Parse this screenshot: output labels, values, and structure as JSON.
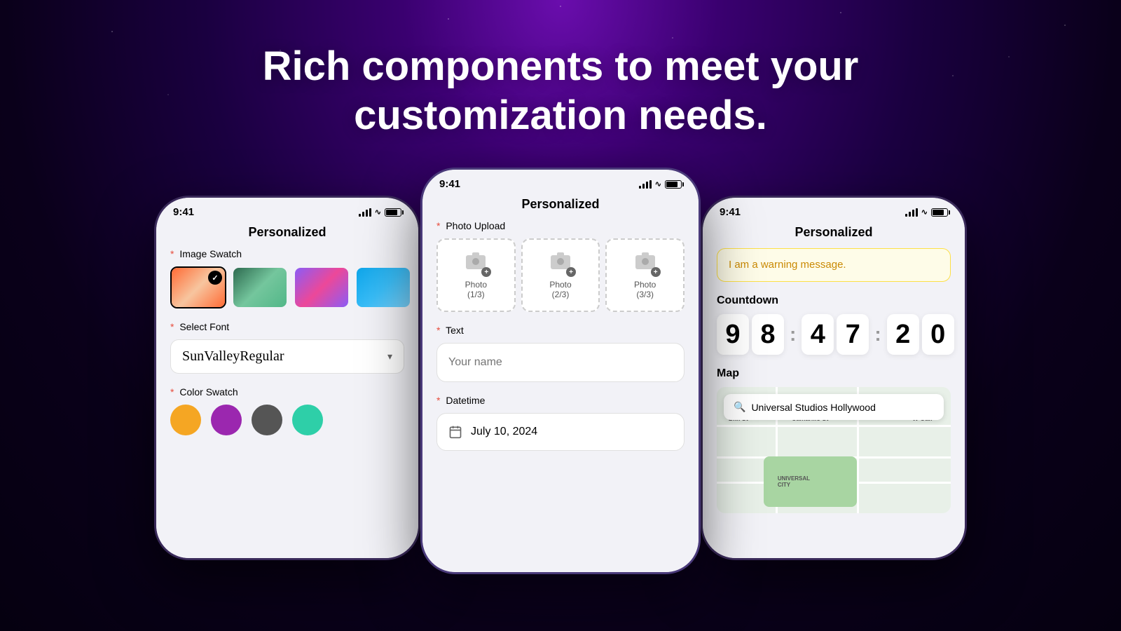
{
  "page": {
    "title_line1": "Rich components to meet  your",
    "title_line2": "customization needs."
  },
  "phone_left": {
    "status_time": "9:41",
    "screen_title": "Personalized",
    "image_swatch": {
      "label": "Image Swatch",
      "required": "*",
      "swatches": [
        {
          "id": "swatch-1",
          "selected": true
        },
        {
          "id": "swatch-2",
          "selected": false
        },
        {
          "id": "swatch-3",
          "selected": false
        },
        {
          "id": "swatch-4",
          "selected": false
        }
      ]
    },
    "font_select": {
      "label": "Select Font",
      "required": "*",
      "value": "SunValleyRegular"
    },
    "color_swatch": {
      "label": "Color Swatch",
      "required": "*",
      "colors": [
        "#f5a623",
        "#9b27af",
        "#555555",
        "#2ecfa8"
      ]
    }
  },
  "phone_center": {
    "status_time": "9:41",
    "screen_title": "Personalized",
    "photo_upload": {
      "label": "Photo Upload",
      "required": "*",
      "items": [
        {
          "label": "Photo",
          "sublabel": "(1/3)"
        },
        {
          "label": "Photo",
          "sublabel": "(2/3)"
        },
        {
          "label": "Photo",
          "sublabel": "(3/3)"
        }
      ]
    },
    "text_field": {
      "label": "Text",
      "required": "*",
      "placeholder": "Your name"
    },
    "datetime_field": {
      "label": "Datetime",
      "required": "*",
      "value": "July 10, 2024"
    }
  },
  "phone_right": {
    "status_time": "9:41",
    "screen_title": "Personalized",
    "warning": {
      "message": "I am a warning message."
    },
    "countdown": {
      "label": "Countdown",
      "digits": [
        "9",
        "8",
        "4",
        "7",
        "2",
        "0"
      ]
    },
    "map": {
      "label": "Map",
      "search_text": "Universal Studios Hollywood"
    }
  }
}
